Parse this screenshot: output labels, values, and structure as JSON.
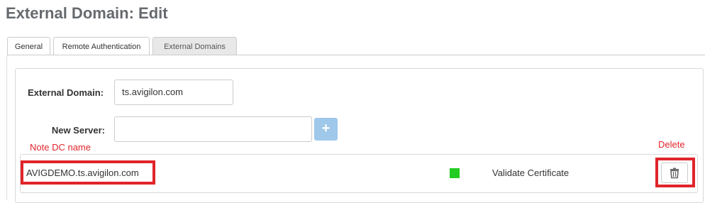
{
  "page": {
    "title": "External Domain: Edit"
  },
  "tabs": [
    {
      "label": "General"
    },
    {
      "label": "Remote Authentication"
    },
    {
      "label": "External Domains"
    }
  ],
  "form": {
    "external_domain_label": "External Domain:",
    "external_domain_value": "ts.avigilon.com",
    "new_server_label": "New Server:",
    "new_server_value": "",
    "add_button": "+"
  },
  "server_row": {
    "name": "AVIGDEMO.ts.avigilon.com",
    "status_color": "#22cc22",
    "validate_label": "Validate Certificate"
  },
  "annotations": {
    "note": "Note DC name",
    "delete": "Delete",
    "highlight_color": "#e0242a"
  },
  "icons": {
    "delete": "trash-icon",
    "add": "plus-icon"
  }
}
